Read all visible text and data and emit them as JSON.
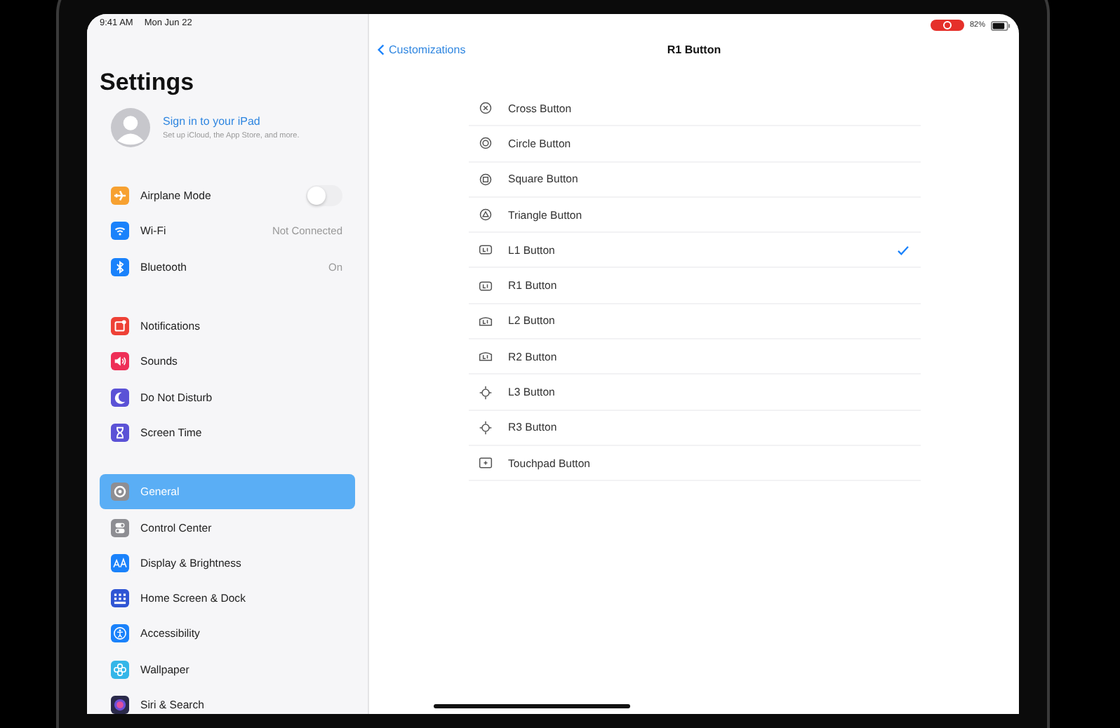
{
  "status_bar": {
    "time": "9:41 AM",
    "date": "Mon Jun 22",
    "battery": "82%"
  },
  "sidebar": {
    "title": "Settings",
    "account": {
      "title": "Sign in to your iPad",
      "subtitle": "Set up iCloud, the App Store, and more."
    },
    "groups": [
      [
        {
          "label": "Airplane Mode",
          "kind": "airplane",
          "color": "#f7a131",
          "on": false,
          "selected": false
        },
        {
          "label": "Wi-Fi",
          "kind": "wifi",
          "color": "#1a82fb",
          "value": "Not Connected",
          "selected": false
        },
        {
          "label": "Bluetooth",
          "kind": "bluetooth",
          "color": "#1a82fb",
          "value": "On",
          "selected": false
        }
      ],
      [
        {
          "label": "Notifications",
          "kind": "notifications",
          "color": "#ee4136",
          "selected": false
        },
        {
          "label": "Sounds",
          "kind": "sounds",
          "color": "#ee2f57",
          "selected": false
        },
        {
          "label": "Do Not Disturb",
          "kind": "moon",
          "color": "#5b52d6",
          "selected": false
        },
        {
          "label": "Screen Time",
          "kind": "hourglass",
          "color": "#5b52d6",
          "selected": false
        }
      ],
      [
        {
          "label": "General",
          "kind": "gear",
          "color": "#8e8e93",
          "selected": true
        },
        {
          "label": "Control Center",
          "kind": "switches",
          "color": "#8e8e93",
          "selected": false
        },
        {
          "label": "Display & Brightness",
          "kind": "text-size",
          "color": "#1a82fb",
          "selected": false
        },
        {
          "label": "Home Screen & Dock",
          "kind": "grid",
          "color": "#2f55d4",
          "selected": false
        },
        {
          "label": "Accessibility",
          "kind": "accessibility",
          "color": "#1a82fb",
          "selected": false
        },
        {
          "label": "Wallpaper",
          "kind": "flower",
          "color": "#35b6e8",
          "selected": false
        },
        {
          "label": "Siri & Search",
          "kind": "siri",
          "color": "#2a2a4a",
          "selected": false
        }
      ]
    ]
  },
  "detail": {
    "back": "Customizations",
    "title": "R1 Button",
    "options": [
      {
        "label": "Cross Button",
        "kind": "cross",
        "selected": false
      },
      {
        "label": "Circle Button",
        "kind": "circle",
        "selected": false
      },
      {
        "label": "Square Button",
        "kind": "square",
        "selected": false
      },
      {
        "label": "Triangle Button",
        "kind": "triangle",
        "selected": false
      },
      {
        "label": "L1 Button",
        "kind": "bumper",
        "selected": true
      },
      {
        "label": "R1 Button",
        "kind": "bumper",
        "selected": false
      },
      {
        "label": "L2 Button",
        "kind": "trigger",
        "selected": false
      },
      {
        "label": "R2 Button",
        "kind": "trigger",
        "selected": false
      },
      {
        "label": "L3 Button",
        "kind": "stick",
        "selected": false
      },
      {
        "label": "R3 Button",
        "kind": "stick",
        "selected": false
      },
      {
        "label": "Touchpad Button",
        "kind": "touchpad",
        "selected": false
      }
    ]
  }
}
